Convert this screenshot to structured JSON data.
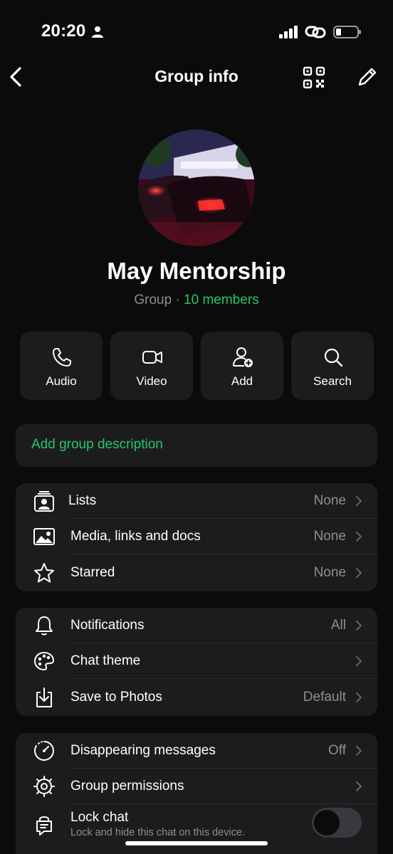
{
  "status_bar": {
    "time": "20:20"
  },
  "nav": {
    "title": "Group info"
  },
  "group": {
    "name": "May Mentorship",
    "type": "Group",
    "separator": "·",
    "members": "10 members"
  },
  "actions": [
    {
      "label": "Audio",
      "icon": "phone-icon"
    },
    {
      "label": "Video",
      "icon": "video-icon"
    },
    {
      "label": "Add",
      "icon": "add-person-icon"
    },
    {
      "label": "Search",
      "icon": "search-icon"
    }
  ],
  "description": {
    "placeholder": "Add group description"
  },
  "section1": [
    {
      "label": "Lists",
      "value": "None",
      "icon": "lists-icon"
    },
    {
      "label": "Media, links and docs",
      "value": "None",
      "icon": "image-icon"
    },
    {
      "label": "Starred",
      "value": "None",
      "icon": "star-icon"
    }
  ],
  "section2": [
    {
      "label": "Notifications",
      "value": "All",
      "icon": "bell-icon"
    },
    {
      "label": "Chat theme",
      "value": "",
      "icon": "palette-icon"
    },
    {
      "label": "Save to Photos",
      "value": "Default",
      "icon": "download-icon"
    }
  ],
  "section3": [
    {
      "label": "Disappearing messages",
      "value": "Off",
      "icon": "timer-icon"
    },
    {
      "label": "Group permissions",
      "value": "",
      "icon": "gear-icon"
    },
    {
      "label": "Lock chat",
      "sublabel": "Lock and hide this chat on this device.",
      "toggle": false,
      "icon": "lock-chat-icon"
    }
  ],
  "colors": {
    "accent": "#25c865",
    "background": "#0b0b0b",
    "card": "#1c1c1e",
    "secondary_text": "#8e8e93"
  }
}
